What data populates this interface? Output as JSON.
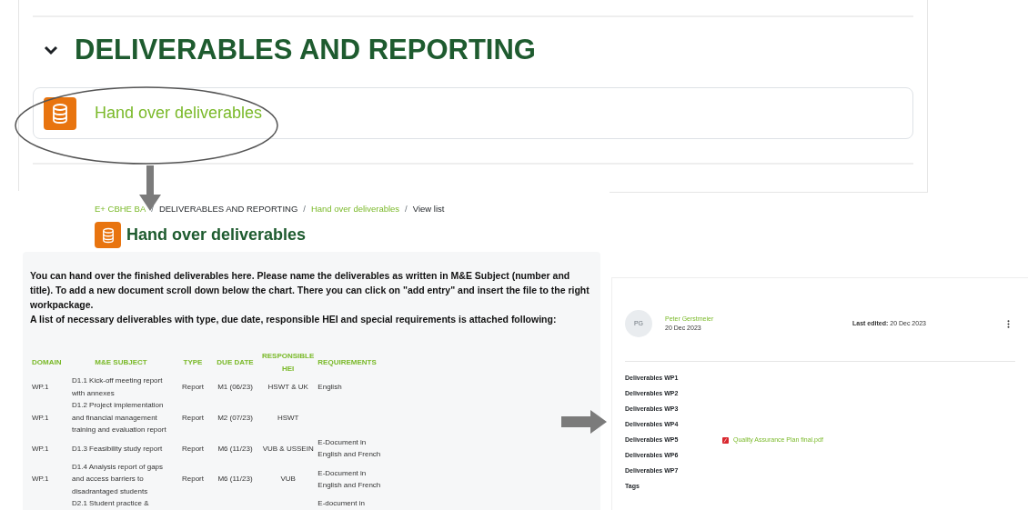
{
  "section": {
    "title": "DELIVERABLES AND REPORTING",
    "expanded": true,
    "activity": "Hand over deliverables"
  },
  "page": {
    "breadcrumb": [
      {
        "label": "E+ CBHE BA",
        "link": true
      },
      {
        "label": "DELIVERABLES AND REPORTING",
        "link": false
      },
      {
        "label": "Hand over deliverables",
        "link": true
      },
      {
        "label": "View list",
        "link": false
      }
    ],
    "separator": "/",
    "title": "Hand over deliverables",
    "intro": [
      "You can hand over the finished deliverables here. Please name the deliverables as written in M&E Subject (number and title). To add a new document scroll down below the chart. There you can click on \"add entry\" and insert the file to the right workpackage.",
      "A list of necessary deliverables with type, due date, responsible HEI and special requirements is attached following:"
    ],
    "table": {
      "columns": [
        "DOMAIN",
        "M&E SUBJECT",
        "TYPE",
        "DUE DATE",
        "RESPONSIBLE HEI",
        "REQUIREMENTS"
      ],
      "rows": [
        {
          "domain": "WP.1",
          "subject": "D1.1 Kick-off meeting report with annexes",
          "type": "Report",
          "due": "M1 (06/23)",
          "hei": "HSWT & UK",
          "requirements": "English"
        },
        {
          "domain": "WP.1",
          "subject": "D1.2 Project implementation and financial management training and evaluation report",
          "type": "Report",
          "due": "M2 (07/23)",
          "hei": "HSWT",
          "requirements": ""
        },
        {
          "domain": "WP.1",
          "subject": "D1.3 Feasibility study report",
          "type": "Report",
          "due": "M6 (11/23)",
          "hei": "VUB & USSEIN",
          "requirements": "E-Document in English and French"
        },
        {
          "domain": "WP.1",
          "subject": "D1.4 Analysis report of gaps and access barriers to disadrantaged students",
          "type": "Report",
          "due": "M6 (11/23)",
          "hei": "VUB",
          "requirements": "E-Document in English and French"
        },
        {
          "domain": "",
          "subject": "D2.1 Student practice &",
          "type": "",
          "due": "",
          "hei": "",
          "requirements": "E-document in"
        }
      ]
    }
  },
  "entry": {
    "initials": "PG",
    "author": "Peter Gerstmeier",
    "date": "20 Dec 2023",
    "last_edited": "**Last edited:** 20 Dec 2023",
    "fields": [
      {
        "label": "Deliverables WP1"
      },
      {
        "label": "Deliverables WP2"
      },
      {
        "label": "Deliverables WP3"
      },
      {
        "label": "Deliverables WP4"
      },
      {
        "label": "Deliverables WP5",
        "file": "Quality Assurance Plan final.pdf"
      },
      {
        "label": "Deliverables WP6"
      },
      {
        "label": "Deliverables WP7"
      },
      {
        "label": "Tags"
      }
    ]
  }
}
